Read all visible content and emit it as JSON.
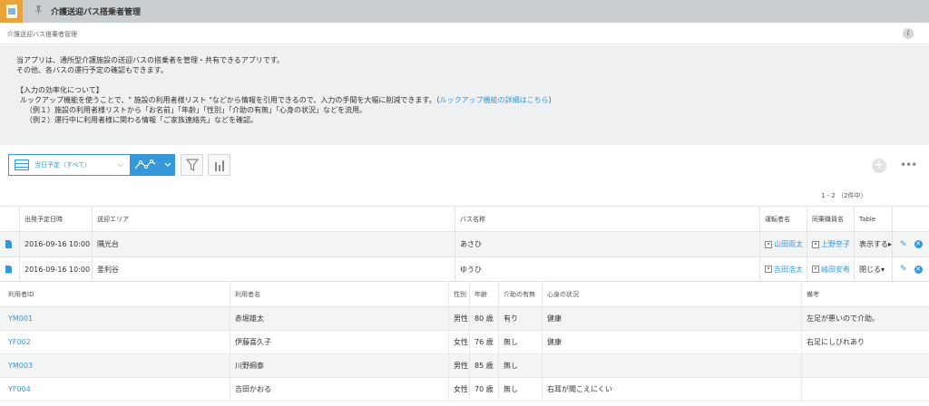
{
  "header": {
    "app_title": "介護送迎バス搭乗者管理",
    "breadcrumb": "介護送迎バス搭乗者管理",
    "icons": {
      "app": "app-folder-icon",
      "pin": "pin-icon",
      "info": "info-icon"
    }
  },
  "description": {
    "line1": "当アプリは、通所型介護施設の送迎バスの搭乗者を管理・共有できるアプリです。",
    "line2": "その他、各バスの運行予定の確認もできます。",
    "line3": "【入力の効率化について】",
    "line4_pre": "ルックアップ機能を使うことで、\" 施設の利用者様リスト \"などから情報を引用できるので、入力の手間を大幅に削減できます。（",
    "line4_link": "ルックアップ機能の詳細はこちら",
    "line4_post": "）",
    "line5": "（例１）施設の利用者様リストから「お名前」「年齢」「性別」「介助の有無」「心身の状況」などを流用。",
    "line6": "（例２）運行中に利用者様に関わる情報「ご家族連絡先」などを確認。"
  },
  "toolbar": {
    "view_label": "当日予定（すべて）",
    "chevron": "⌵",
    "icons": [
      "table-icon",
      "graph-icon",
      "filter-icon",
      "bar-chart-icon",
      "add-icon",
      "more-icon"
    ]
  },
  "pager": "1 - 2 （2件中）",
  "table": {
    "headers": [
      "出発予定日時",
      "送迎エリア",
      "バス名称",
      "運転者名",
      "同乗職員名",
      "Table"
    ],
    "rows": [
      {
        "datetime": "2016-09-16 10:00",
        "area": "隅光台",
        "bus": "あさひ",
        "driver": "山田雨太",
        "staff": "上野奈子",
        "table": "表示する▸"
      },
      {
        "datetime": "2016-09-16 10:00",
        "area": "釜利谷",
        "bus": "ゆうひ",
        "driver": "吉田浩太",
        "staff": "嶋田安希",
        "table": "閉じる▾"
      }
    ]
  },
  "subtable": {
    "headers": [
      "利用者ID",
      "利用者名",
      "性別",
      "年齢",
      "介助の有無",
      "心身の状況",
      "備考"
    ],
    "rows": [
      {
        "id": "YM001",
        "name": "赤堀雄太",
        "sex": "男性",
        "age": "80 歳",
        "assist": "有り",
        "condition": "健康",
        "note": "左足が悪いので介助。"
      },
      {
        "id": "YF002",
        "name": "伊藤喜久子",
        "sex": "女性",
        "age": "76 歳",
        "assist": "無し",
        "condition": "健康",
        "note": "右足にしびれあり"
      },
      {
        "id": "YM003",
        "name": "川野綱泰",
        "sex": "男性",
        "age": "85 歳",
        "assist": "無し",
        "condition": "",
        "note": ""
      },
      {
        "id": "YF004",
        "name": "吉田かおる",
        "sex": "女性",
        "age": "70 歳",
        "assist": "無し",
        "condition": "右耳が聞こえにくい",
        "note": ""
      }
    ]
  }
}
